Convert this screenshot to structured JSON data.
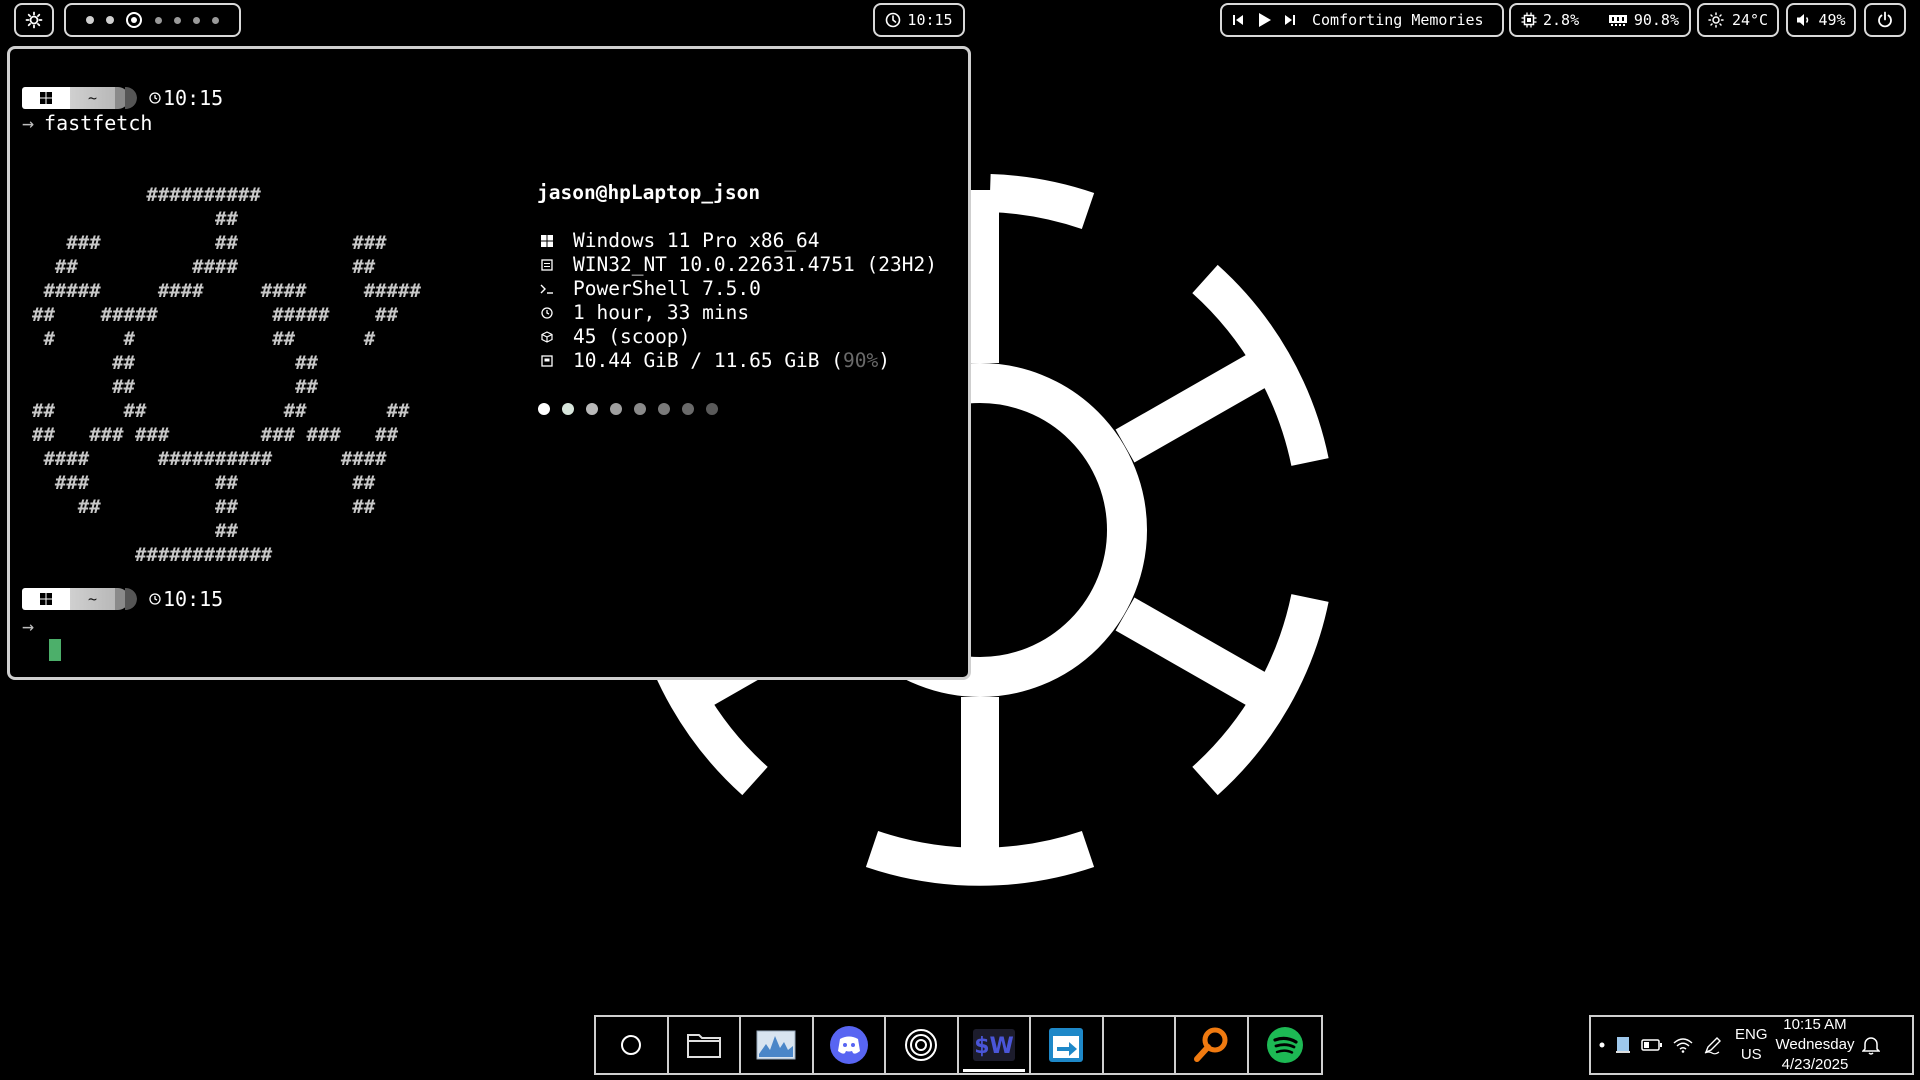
{
  "topbar": {
    "menu_icon": "sun-gear-icon",
    "workspaces": {
      "count": 7,
      "active_index": 2
    },
    "clock": {
      "time": "10:15"
    },
    "media": {
      "title": "Comforting Memories"
    },
    "stats": {
      "cpu": "2.8%",
      "memory": "90.8%"
    },
    "temperature": "24°C",
    "volume": "49%"
  },
  "terminal": {
    "prompt1": {
      "dir": "~",
      "time": "10:15"
    },
    "command": "fastfetch",
    "prompt2": {
      "dir": "~",
      "time": "10:15"
    },
    "ascii_art": "          ##########\n                ##\n   ###          ##          ###\n  ##          ####          ##\n #####     ####     ####     #####\n##    #####          #####    ##\n #      #            ##      #\n       ##              ##\n       ##              ##\n##      ##            ##       ##\n##   ### ###        ### ###   ##\n ####      ##########      ####\n  ###           ##          ##\n    ##          ##          ##\n                ##\n         ############",
    "info": {
      "user": "jason@hpLaptop_json",
      "os": "Windows 11 Pro x86_64",
      "kernel": "WIN32_NT 10.0.22631.4751 (23H2)",
      "shell": "PowerShell 7.5.0",
      "uptime": "1 hour, 33 mins",
      "packages": "45 (scoop)",
      "memory_used": "10.44 GiB / 11.65 GiB (",
      "memory_pct": "90%",
      "memory_close": ")"
    },
    "palette": [
      "#ffffff",
      "#d8e6dc",
      "#b9b9b9",
      "#a0a0a0",
      "#8a8a8a",
      "#7a7a7a",
      "#6a6a6a",
      "#5a5a5a"
    ],
    "cursor_color": "#4caf6a"
  },
  "taskbar": {
    "apps": [
      {
        "name": "start-icon"
      },
      {
        "name": "file-explorer-icon"
      },
      {
        "name": "task-manager-icon"
      },
      {
        "name": "discord-icon",
        "color": "#5865f2"
      },
      {
        "name": "spiral-app-icon"
      },
      {
        "name": "terminal-app-icon",
        "label": "$W",
        "color": "#4a55d8",
        "active": true
      },
      {
        "name": "remote-app-icon",
        "color": "#1e88c8"
      },
      {
        "name": "blank-app-icon"
      },
      {
        "name": "search-app-icon",
        "color": "#f07a10"
      },
      {
        "name": "spotify-icon",
        "color": "#1db954"
      }
    ]
  },
  "tray": {
    "language": "ENG",
    "region": "US",
    "time": "10:15 AM",
    "day": "Wednesday",
    "date": "4/23/2025"
  }
}
